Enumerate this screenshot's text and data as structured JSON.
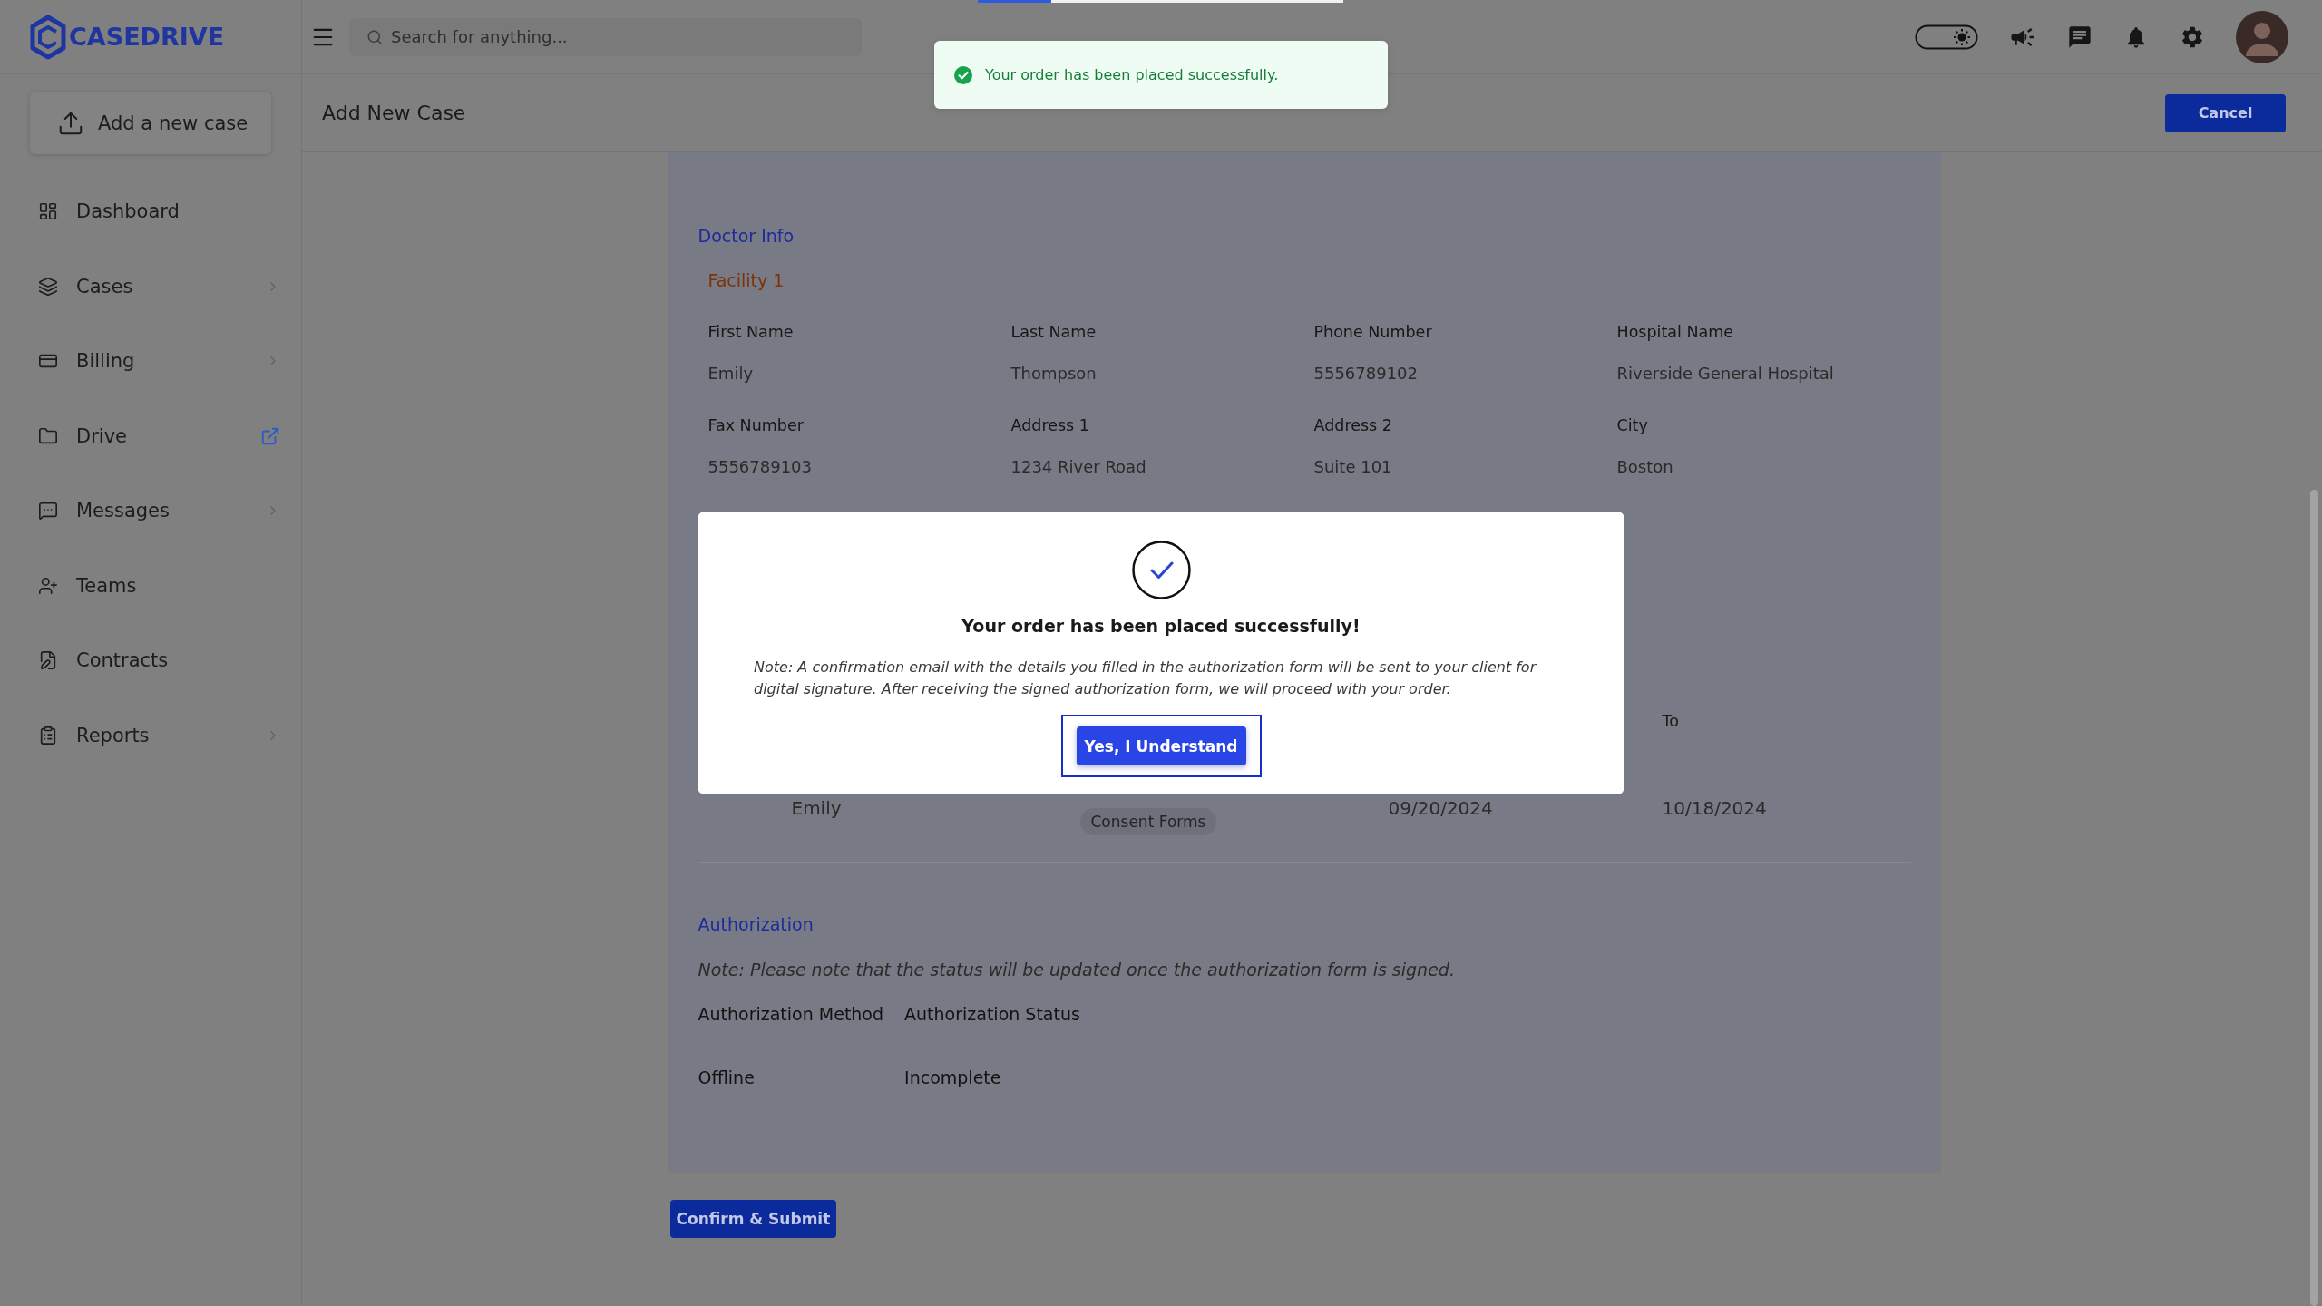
{
  "header": {
    "logo": "CASEDRIVE",
    "search": {
      "placeholder": "Search for anything..."
    }
  },
  "loading_bar": {
    "level": 0.2
  },
  "toast": {
    "kind": "success",
    "message": "Your order has been placed successfully."
  },
  "sidebar": {
    "add_button": "Add a new case",
    "items": [
      {
        "label": "Dashboard",
        "kind": "plain",
        "selected": false
      },
      {
        "label": "Cases",
        "kind": "submenu",
        "selected": false
      },
      {
        "label": "Billing",
        "kind": "submenu",
        "selected": false
      },
      {
        "label": "Drive",
        "kind": "external",
        "selected": false
      },
      {
        "label": "Messages",
        "kind": "submenu",
        "selected": false
      },
      {
        "label": "Teams",
        "kind": "plain",
        "selected": false
      },
      {
        "label": "Contracts",
        "kind": "plain",
        "selected": false
      },
      {
        "label": "Reports",
        "kind": "submenu",
        "selected": false
      }
    ]
  },
  "page": {
    "title": "Add New Case",
    "cancel_button": "Cancel"
  },
  "doctor_info": {
    "heading": "Doctor Info",
    "facility": "Facility 1",
    "fields": [
      {
        "label": "First Name",
        "value": "Emily"
      },
      {
        "label": "Last Name",
        "value": "Thompson"
      },
      {
        "label": "Phone Number",
        "value": "5556789102"
      },
      {
        "label": "Hospital Name",
        "value": "Riverside General Hospital"
      },
      {
        "label": "Fax Number",
        "value": "5556789103"
      },
      {
        "label": "Address 1",
        "value": "1234 River Road"
      },
      {
        "label": "Address 2",
        "value": "Suite 101"
      },
      {
        "label": "City",
        "value": "Boston"
      }
    ]
  },
  "table": {
    "columns": [
      {},
      {},
      {},
      {
        "label": "To"
      }
    ],
    "rows": [
      {
        "cells": [
          {
            "kind": "text",
            "text": "Emily"
          },
          {
            "kind": "tag",
            "text": "Consent Forms"
          },
          {
            "kind": "text",
            "text": "09/20/2024"
          },
          {
            "kind": "text",
            "text": "10/18/2024"
          }
        ]
      }
    ]
  },
  "authorization": {
    "heading": "Authorization",
    "note": "Note: Please note that the status will be updated once the authorization form is signed.",
    "fields": [
      {
        "label": "Authorization Method",
        "value": "Offline"
      },
      {
        "label": "Authorization Status",
        "value": "Incomplete"
      }
    ]
  },
  "confirm_button": "Confirm & Submit",
  "modal": {
    "title": "Your order has been placed successfully!",
    "note": "Note: A confirmation email with the details you filled in the authorization form will be sent to your client for digital signature. After receiving the signed authorization form, we will proceed with your order.",
    "button": "Yes, I Understand",
    "focused": true
  }
}
